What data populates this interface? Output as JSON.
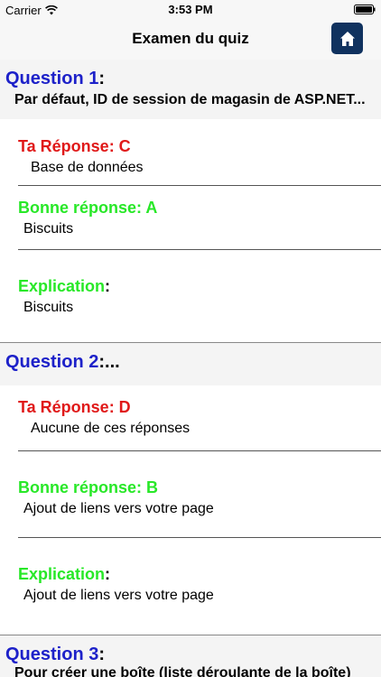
{
  "status_bar": {
    "carrier": "Carrier",
    "time": "3:53 PM"
  },
  "nav": {
    "title": "Examen du quiz",
    "home_icon": "home-icon"
  },
  "questions": [
    {
      "label": "Question 1",
      "colon": ":",
      "text": "Par défaut, ID de session de magasin de ASP.NET...",
      "your_answer_label": "Ta Réponse: C",
      "your_answer_text": "Base de données",
      "correct_label": "Bonne réponse: A",
      "correct_text": "Biscuits",
      "explanation_label": "Explication",
      "explanation_colon": ":",
      "explanation_text": "Biscuits"
    },
    {
      "label": "Question 2",
      "colon": ":...",
      "your_answer_label": "Ta Réponse: D",
      "your_answer_text": "Aucune de ces réponses",
      "correct_label": "Bonne réponse: B",
      "correct_text": "Ajout de liens vers votre page",
      "explanation_label": "Explication",
      "explanation_colon": ":",
      "explanation_text": "Ajout de liens vers votre page"
    },
    {
      "label": "Question 3",
      "colon": ":",
      "text": "Pour créer une boîte (liste déroulante de la boîte)"
    }
  ],
  "colors": {
    "question_blue": "#1d21c9",
    "wrong_red": "#e01919",
    "correct_green": "#28e828",
    "home_button_bg": "#10325f"
  }
}
